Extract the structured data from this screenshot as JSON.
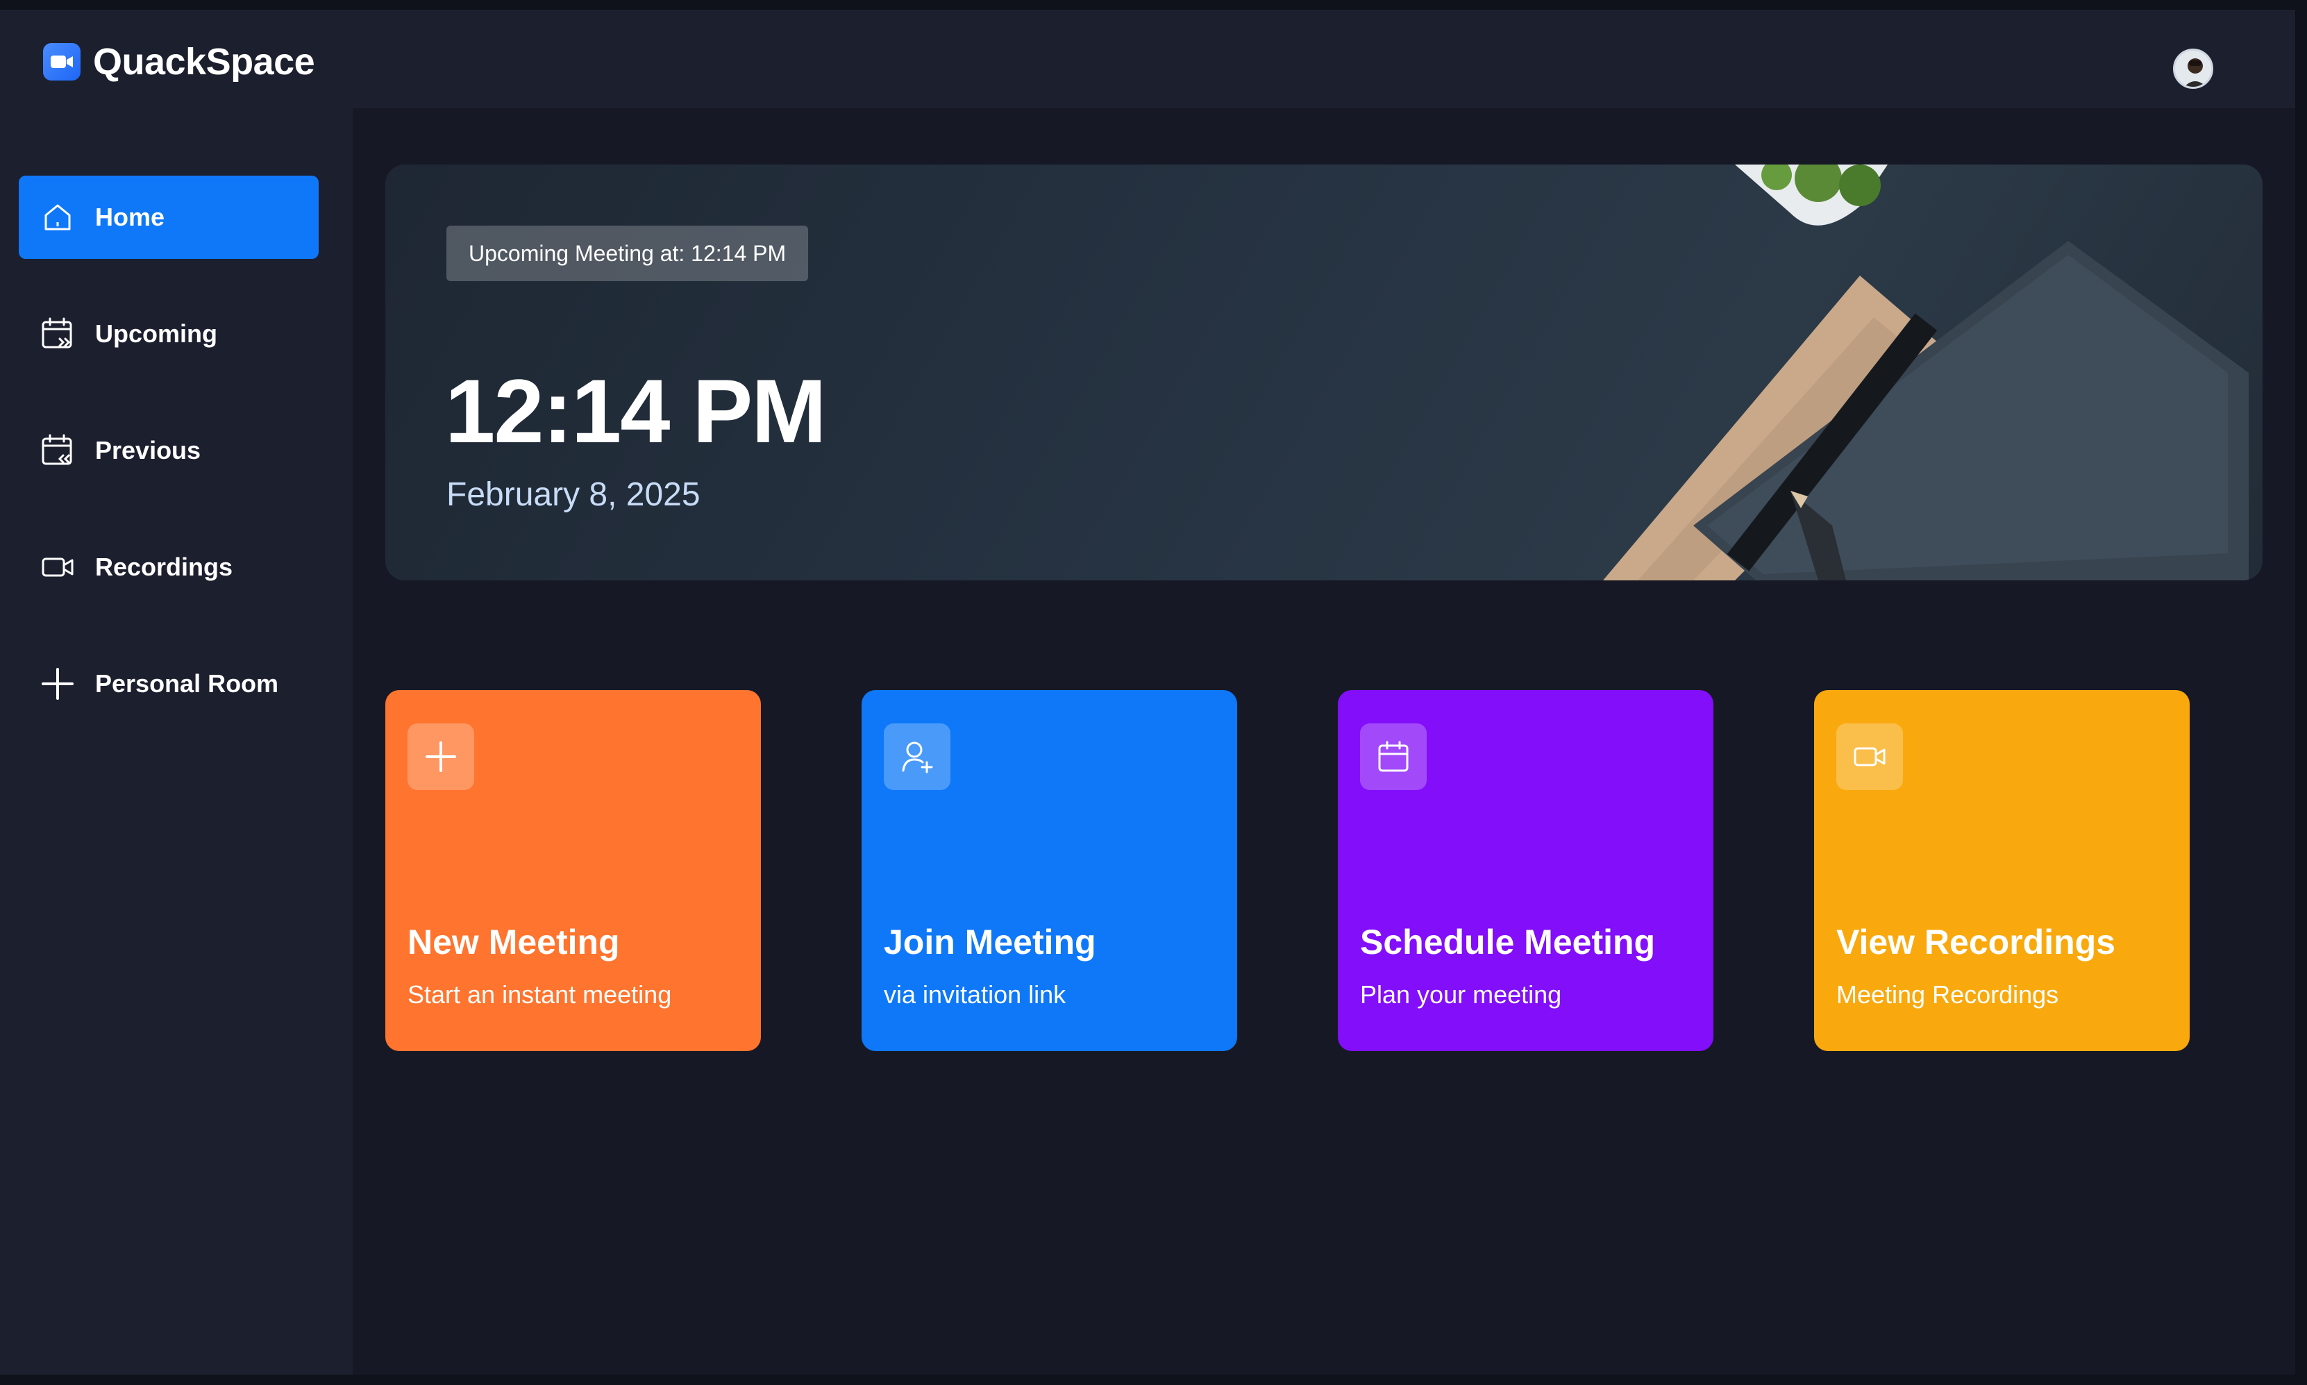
{
  "app": {
    "name": "QuackSpace"
  },
  "sidebar": {
    "items": [
      {
        "label": "Home",
        "icon": "home-icon",
        "active": true
      },
      {
        "label": "Upcoming",
        "icon": "calendar-forward-icon"
      },
      {
        "label": "Previous",
        "icon": "calendar-back-icon"
      },
      {
        "label": "Recordings",
        "icon": "video-icon"
      },
      {
        "label": "Personal Room",
        "icon": "plus-icon"
      }
    ]
  },
  "hero": {
    "badge": "Upcoming Meeting at: 12:14 PM",
    "time": "12:14 PM",
    "date": "February 8, 2025"
  },
  "cards": [
    {
      "title": "New Meeting",
      "subtitle": "Start an instant meeting",
      "icon": "plus-icon",
      "color": "#ff742e"
    },
    {
      "title": "Join Meeting",
      "subtitle": "via invitation link",
      "icon": "user-add-icon",
      "color": "#0e78f9"
    },
    {
      "title": "Schedule Meeting",
      "subtitle": "Plan your meeting",
      "icon": "calendar-icon",
      "color": "#830ef9"
    },
    {
      "title": "View Recordings",
      "subtitle": "Meeting Recordings",
      "icon": "video-icon",
      "color": "#f9a90e"
    }
  ],
  "colors": {
    "background": "#1c1f2e",
    "main": "#161925",
    "accent": "#0e78f9"
  }
}
